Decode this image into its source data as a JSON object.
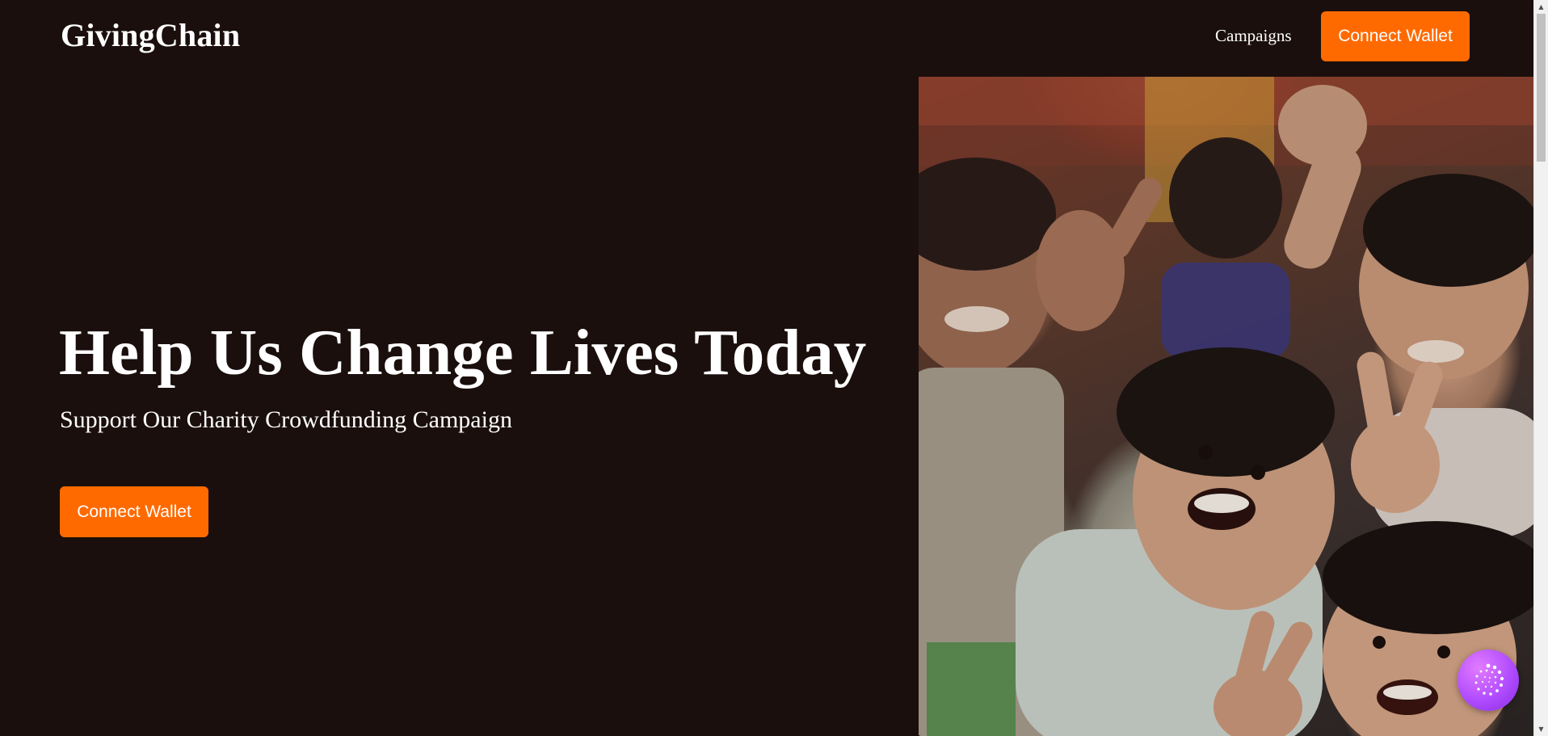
{
  "header": {
    "brand": "GivingChain",
    "nav": {
      "campaigns_label": "Campaigns"
    },
    "connect_wallet_label": "Connect Wallet"
  },
  "hero": {
    "title": "Help Us Change Lives Today",
    "subtitle": "Support Our Charity Crowdfunding Campaign",
    "cta_label": "Connect Wallet",
    "image_alt_icon": "photo-children-smiling"
  },
  "floating": {
    "assistant_icon": "spiral-dots-icon"
  },
  "colors": {
    "background": "#1a0f0c",
    "accent": "#ff6a00",
    "text": "#ffffff",
    "assistant": "#b14cff"
  }
}
